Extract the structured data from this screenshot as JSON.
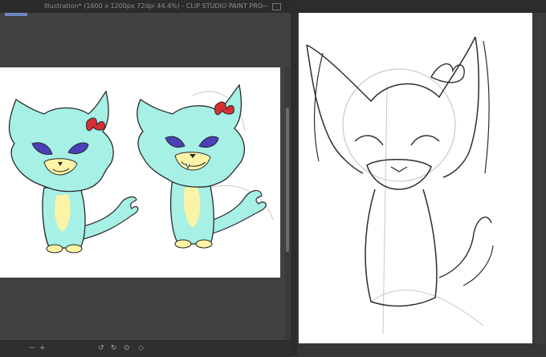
{
  "window": {
    "title": "Illustration* (1600 x 1200px 72dpi 44.4%) - CLIP STUDIO PAINT PRO"
  },
  "status": {
    "zoom_minus": "−",
    "zoom_plus": "+",
    "rotate_icon": "rotate-icon"
  },
  "colors": {
    "character_fill": "#a6f0e6",
    "belly_fill": "#fbf3a6",
    "eye_fill": "#4a40b8",
    "bow_fill": "#d52f35",
    "ui_dark": "#2b2b2b",
    "ui_mid": "#414141",
    "accent": "#6f86c8"
  }
}
